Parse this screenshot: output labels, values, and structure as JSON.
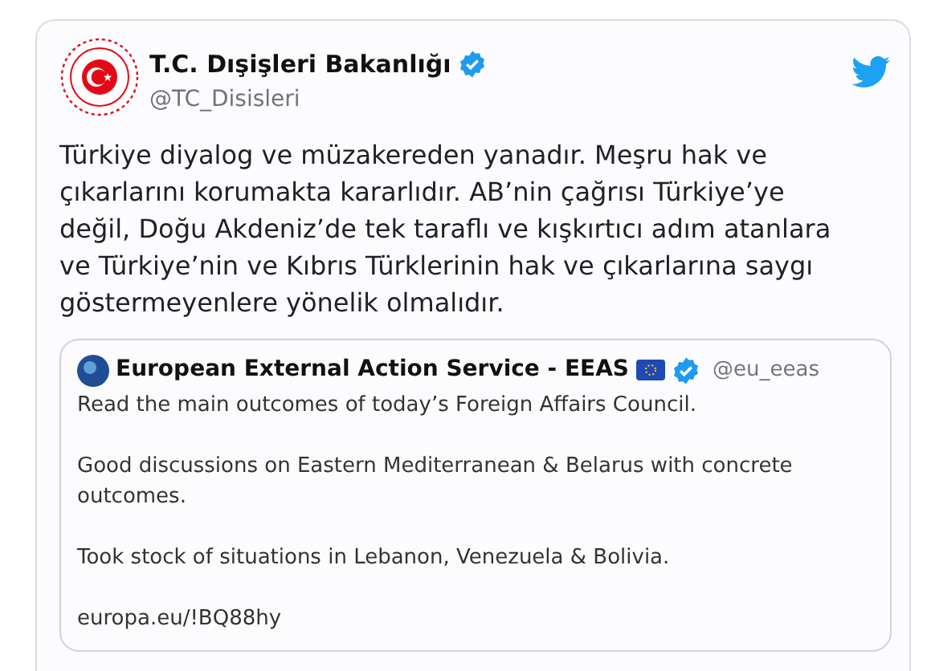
{
  "tweet": {
    "author": {
      "name": "T.C. Dışişleri Bakanlığı",
      "handle": "@TC_Disisleri",
      "verified": true
    },
    "text": "Türkiye diyalog ve müzakereden yanadır. Meşru hak ve çıkarlarını korumakta kararlıdır. AB’nin çağrısı Türkiye’ye değil, Doğu Akdeniz’de tek taraflı ve kışkırtıcı adım atanlara ve Türkiye’nin ve Kıbrıs Türklerinin hak ve çıkarlarına saygı göstermeyenlere yönelik olmalıdır.",
    "quoted": {
      "author": {
        "name": "European External Action Service - EEAS",
        "handle": "@eu_eeas",
        "verified": true
      },
      "paragraphs": [
        "Read the main outcomes of today’s Foreign Affairs Council.",
        "Good discussions on Eastern Mediterranean & Belarus with concrete outcomes.",
        "Took stock of situations in Lebanon, Venezuela & Bolivia.",
        "europa.eu/!BQ88hy"
      ]
    }
  }
}
